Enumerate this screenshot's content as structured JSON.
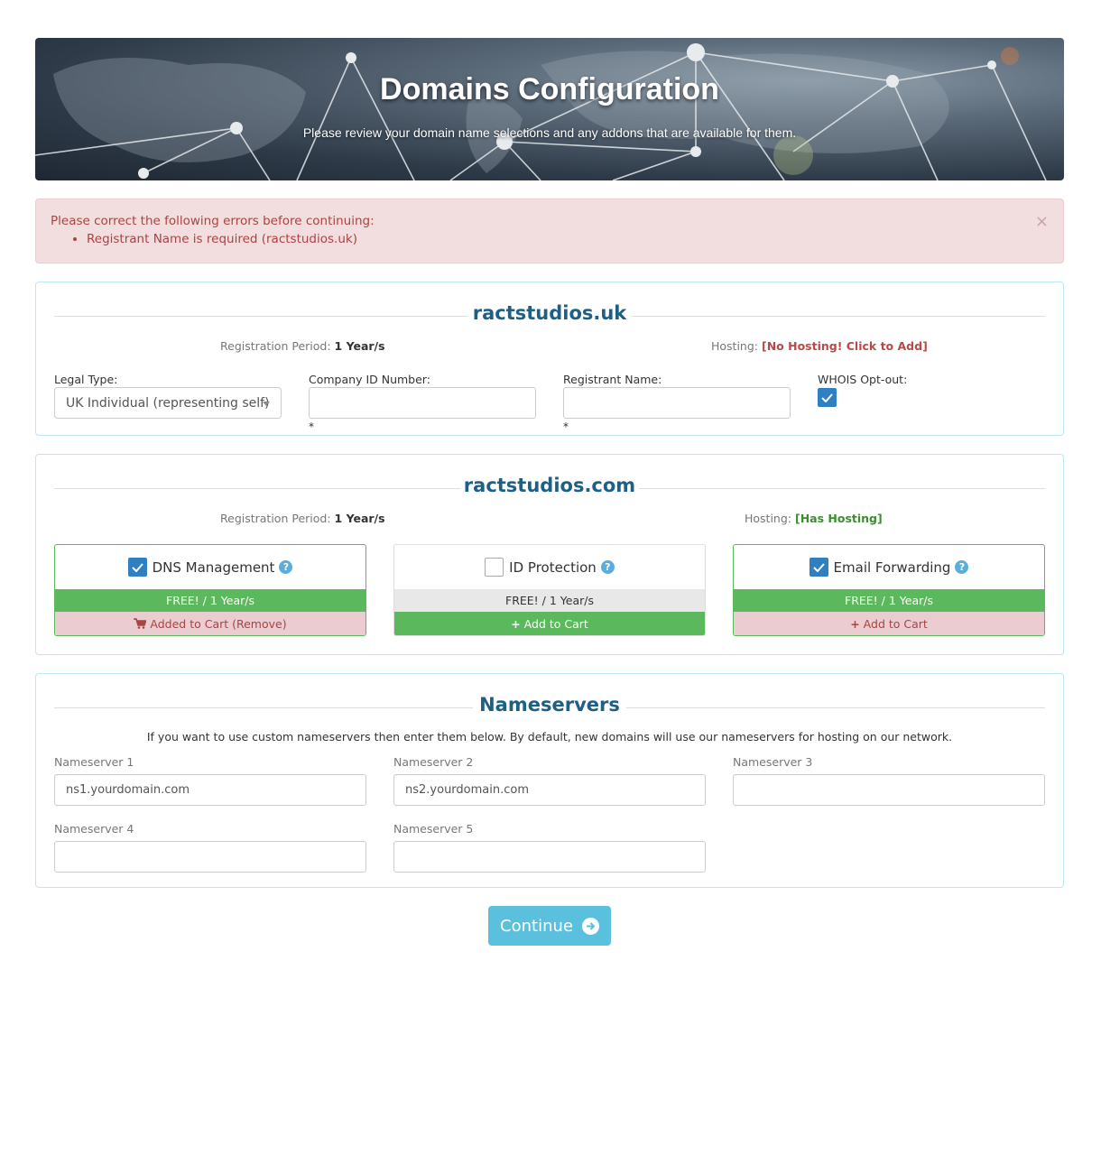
{
  "banner": {
    "title": "Domains Configuration",
    "subtitle": "Please review your domain name selections and any addons that are available for them."
  },
  "alert": {
    "message": "Please correct the following errors before continuing:",
    "errors": [
      "Registrant Name is required (ractstudios.uk)"
    ],
    "close": "×"
  },
  "domain_uk": {
    "name": "ractstudios.uk",
    "period_label": "Registration Period:",
    "period_value": "1 Year/s",
    "hosting_label": "Hosting:",
    "hosting_value": "[No Hosting! Click to Add]",
    "legal_type_label": "Legal Type:",
    "legal_type_value": "UK Individual (representing self)",
    "company_id_label": "Company ID Number:",
    "company_id_value": "",
    "company_id_req": "*",
    "registrant_label": "Registrant Name:",
    "registrant_value": "",
    "registrant_req": "*",
    "whois_label": "WHOIS Opt-out:",
    "whois_checked": true
  },
  "domain_com": {
    "name": "ractstudios.com",
    "period_label": "Registration Period:",
    "period_value": "1 Year/s",
    "hosting_label": "Hosting:",
    "hosting_value": "[Has Hosting]",
    "addons": [
      {
        "name": "DNS Management",
        "checked": true,
        "price": "FREE! / 1 Year/s",
        "cart": "Added to Cart (Remove)"
      },
      {
        "name": "ID Protection",
        "checked": false,
        "price": "FREE! / 1 Year/s",
        "cart": "Add to Cart"
      },
      {
        "name": "Email Forwarding",
        "checked": true,
        "price": "FREE! / 1 Year/s",
        "cart": "Add to Cart"
      }
    ]
  },
  "nameservers": {
    "title": "Nameservers",
    "description": "If you want to use custom nameservers then enter them below. By default, new domains will use our nameservers for hosting on our network.",
    "fields": [
      {
        "label": "Nameserver 1",
        "value": "ns1.yourdomain.com"
      },
      {
        "label": "Nameserver 2",
        "value": "ns2.yourdomain.com"
      },
      {
        "label": "Nameserver 3",
        "value": ""
      },
      {
        "label": "Nameserver 4",
        "value": ""
      },
      {
        "label": "Nameserver 5",
        "value": ""
      }
    ]
  },
  "continue_label": "Continue",
  "colors": {
    "accent": "#5bc0de",
    "title_blue": "#1d5f85",
    "success": "#5cb85c",
    "danger_text": "#a94442",
    "checkbox": "#2f7fc1"
  }
}
